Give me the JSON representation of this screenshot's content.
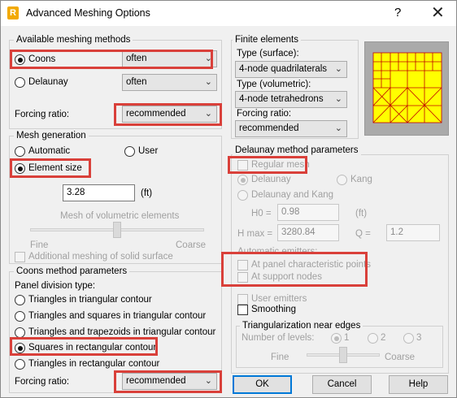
{
  "window": {
    "title": "Advanced Meshing Options",
    "app_icon_letter": "R",
    "help": "?",
    "close": "✕"
  },
  "available": {
    "group": "Available meshing methods",
    "coons_label": "Coons",
    "coons_value": "often",
    "delaunay_label": "Delaunay",
    "delaunay_value": "often",
    "forcing_label": "Forcing ratio:",
    "forcing_value": "recommended"
  },
  "mesh_gen": {
    "group": "Mesh generation",
    "automatic": "Automatic",
    "user": "User",
    "element_size": "Element size",
    "size_value": "3.28",
    "unit": "(ft)",
    "volumetric_label": "Mesh of volumetric elements",
    "fine": "Fine",
    "coarse": "Coarse",
    "slider_position": 0.5,
    "additional": "Additional meshing of solid surface"
  },
  "coons": {
    "group": "Coons method parameters",
    "panel_division": "Panel division type:",
    "options": [
      "Triangles in triangular contour",
      "Triangles and squares in triangular contour",
      "Triangles and trapezoids in triangular contour",
      "Squares in rectangular contour",
      "Triangles in rectangular contour"
    ],
    "selected_index": 3,
    "forcing_label": "Forcing ratio:",
    "forcing_value": "recommended"
  },
  "finite": {
    "group": "Finite elements",
    "surface_label": "Type (surface):",
    "surface_value": "4-node quadrilaterals",
    "volumetric_label": "Type (volumetric):",
    "volumetric_value": "4-node tetrahedrons",
    "forcing_label": "Forcing ratio:",
    "forcing_value": "recommended"
  },
  "delaunay": {
    "group": "Delaunay method parameters",
    "regular_mesh": "Regular mesh",
    "delaunay": "Delaunay",
    "kang": "Kang",
    "delaunay_and_kang": "Delaunay and Kang",
    "h0_label": "H0 =",
    "h0_value": "0.98",
    "h0_unit": "(ft)",
    "hmax_label": "H max =",
    "hmax_value": "3280.84",
    "q_label": "Q =",
    "q_value": "1.2",
    "auto_emitters": "Automatic emitters:",
    "panel_points": "At panel characteristic points",
    "support_nodes": "At support nodes",
    "user_emitters": "User emitters",
    "smoothing": "Smoothing"
  },
  "triangularization": {
    "group": "Triangularization near edges",
    "levels_label": "Number of levels:",
    "levels": [
      "1",
      "2",
      "3"
    ],
    "fine": "Fine",
    "coarse": "Coarse",
    "slider_position": 0.5
  },
  "buttons": {
    "ok": "OK",
    "cancel": "Cancel",
    "help": "Help"
  },
  "colors": {
    "highlight": "#d9403a",
    "mesh_fill": "#ffff00",
    "mesh_lines": "#c00000",
    "default_button_border": "#0078d7"
  },
  "icons": {
    "dropdown": "chevron-down-icon",
    "close": "close-icon",
    "help": "help-icon"
  }
}
